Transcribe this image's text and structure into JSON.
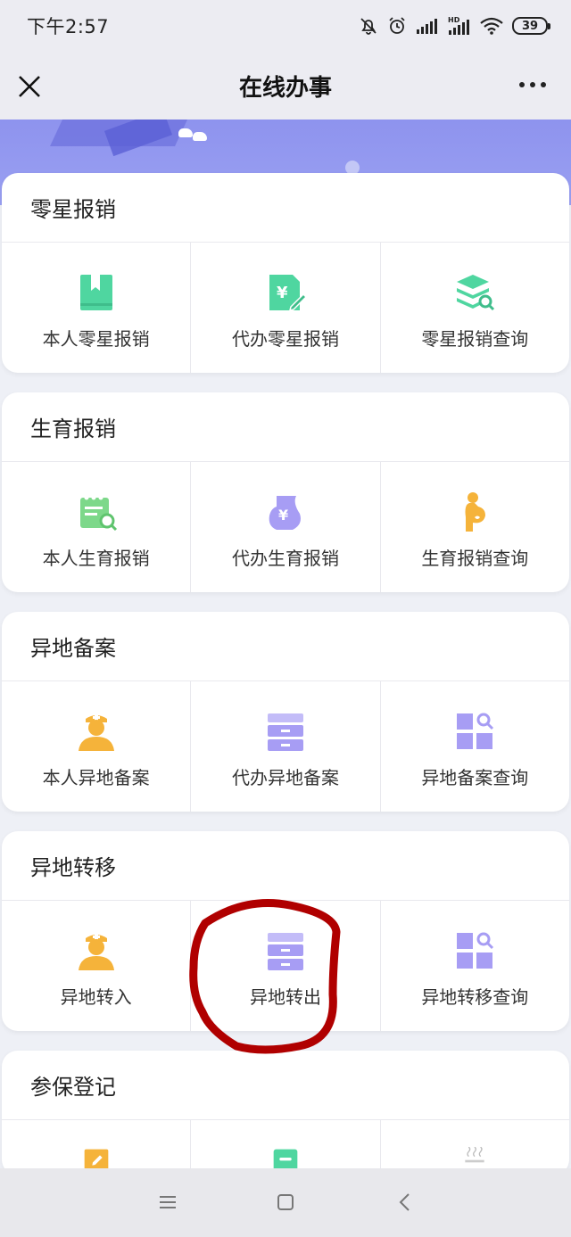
{
  "status_bar": {
    "time": "下午2:57",
    "battery": "39"
  },
  "nav": {
    "title": "在线办事"
  },
  "sections": [
    {
      "title": "零星报销",
      "items": [
        {
          "label": "本人零星报销",
          "icon": "bookmark-book-icon",
          "color": "#4fd6a0"
        },
        {
          "label": "代办零星报销",
          "icon": "yuan-document-edit-icon",
          "color": "#4fd6a0"
        },
        {
          "label": "零星报销查询",
          "icon": "layers-search-icon",
          "color": "#4fd6a0"
        }
      ]
    },
    {
      "title": "生育报销",
      "items": [
        {
          "label": "本人生育报销",
          "icon": "calendar-search-icon",
          "color": "#7dd88a"
        },
        {
          "label": "代办生育报销",
          "icon": "yuan-pregnant-belly-icon",
          "color": "#a79df4"
        },
        {
          "label": "生育报销查询",
          "icon": "pregnant-woman-icon",
          "color": "#f5b33a"
        }
      ]
    },
    {
      "title": "异地备案",
      "items": [
        {
          "label": "本人异地备案",
          "icon": "nurse-avatar-icon",
          "color": "#f5b33a"
        },
        {
          "label": "代办异地备案",
          "icon": "cabinet-drawers-icon",
          "color": "#a79df4"
        },
        {
          "label": "异地备案查询",
          "icon": "grid-search-icon",
          "color": "#a79df4"
        }
      ]
    },
    {
      "title": "异地转移",
      "items": [
        {
          "label": "异地转入",
          "icon": "nurse-avatar-icon",
          "color": "#f5b33a"
        },
        {
          "label": "异地转出",
          "icon": "cabinet-drawers-icon",
          "color": "#a79df4"
        },
        {
          "label": "异地转移查询",
          "icon": "grid-search-icon",
          "color": "#a79df4"
        }
      ]
    },
    {
      "title": "参保登记",
      "items": [
        {
          "label": "",
          "icon": "edit-document-icon",
          "color": "#f5b33a"
        },
        {
          "label": "",
          "icon": "card-icon",
          "color": "#4fd6a0"
        },
        {
          "label": "",
          "icon": "steam-icon",
          "color": "#cccccc"
        }
      ]
    }
  ],
  "annotation": {
    "color": "#b00000",
    "target": "异地转出"
  }
}
